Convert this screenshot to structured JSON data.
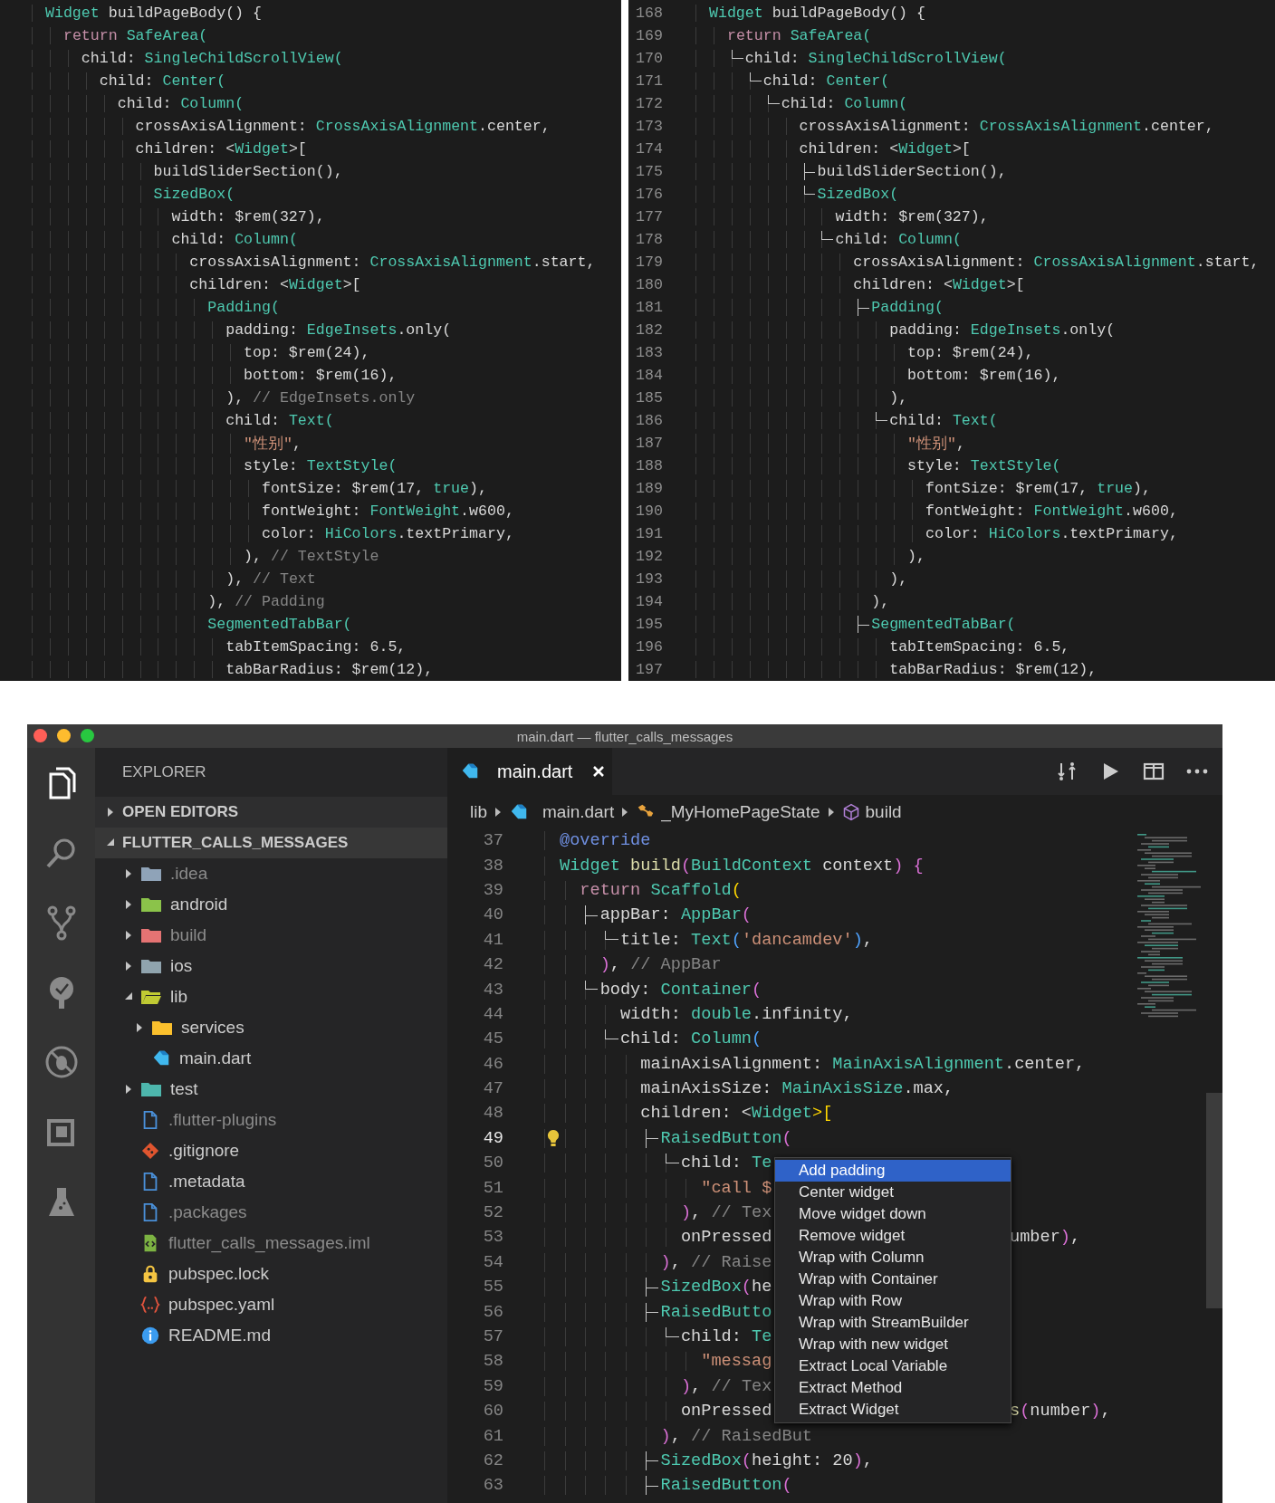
{
  "code_panels": [
    {
      "kind": "plain",
      "lines": [
        {
          "code": [
            {
              "text": "Widget",
              "kind": "type"
            },
            {
              "text": " buildPageBody() {",
              "kind": "plain"
            }
          ]
        },
        {
          "code": [
            {
              "text": "  return",
              "kind": "kw"
            },
            {
              "text": " SafeArea(",
              "kind": "type"
            }
          ]
        },
        {
          "code": [
            {
              "text": "    child: ",
              "kind": "plain"
            },
            {
              "text": "SingleChildScrollView(",
              "kind": "type"
            }
          ]
        },
        {
          "code": [
            {
              "text": "      child: ",
              "kind": "plain"
            },
            {
              "text": "Center(",
              "kind": "type"
            }
          ]
        },
        {
          "code": [
            {
              "text": "        child: ",
              "kind": "plain"
            },
            {
              "text": "Column(",
              "kind": "type"
            }
          ]
        },
        {
          "code": [
            {
              "text": "          crossAxisAlignment: ",
              "kind": "plain"
            },
            {
              "text": "CrossAxisAlignment",
              "kind": "type"
            },
            {
              "text": ".center,",
              "kind": "plain"
            }
          ]
        },
        {
          "code": [
            {
              "text": "          children: <",
              "kind": "plain"
            },
            {
              "text": "Widget",
              "kind": "type"
            },
            {
              "text": ">[",
              "kind": "plain"
            }
          ]
        },
        {
          "code": [
            {
              "text": "            buildSliderSection(),",
              "kind": "plain"
            }
          ]
        },
        {
          "code": [
            {
              "text": "            SizedBox(",
              "kind": "type"
            }
          ]
        },
        {
          "code": [
            {
              "text": "              width: $rem(327),",
              "kind": "plain"
            }
          ]
        },
        {
          "code": [
            {
              "text": "              child: ",
              "kind": "plain"
            },
            {
              "text": "Column(",
              "kind": "type"
            }
          ]
        },
        {
          "code": [
            {
              "text": "                crossAxisAlignment: ",
              "kind": "plain"
            },
            {
              "text": "CrossAxisAlignment",
              "kind": "type"
            },
            {
              "text": ".start,",
              "kind": "plain"
            }
          ]
        },
        {
          "code": [
            {
              "text": "                children: <",
              "kind": "plain"
            },
            {
              "text": "Widget",
              "kind": "type"
            },
            {
              "text": ">[",
              "kind": "plain"
            }
          ]
        },
        {
          "code": [
            {
              "text": "                  Padding(",
              "kind": "type"
            }
          ]
        },
        {
          "code": [
            {
              "text": "                    padding: ",
              "kind": "plain"
            },
            {
              "text": "EdgeInsets",
              "kind": "type"
            },
            {
              "text": ".only(",
              "kind": "plain"
            }
          ]
        },
        {
          "code": [
            {
              "text": "                      top: $rem(24),",
              "kind": "plain"
            }
          ]
        },
        {
          "code": [
            {
              "text": "                      bottom: $rem(16),",
              "kind": "plain"
            }
          ]
        },
        {
          "code": [
            {
              "text": "                    ), ",
              "kind": "plain"
            },
            {
              "text": "// EdgeInsets.only",
              "kind": "comment"
            }
          ]
        },
        {
          "code": [
            {
              "text": "                    child: ",
              "kind": "plain"
            },
            {
              "text": "Text(",
              "kind": "type"
            }
          ]
        },
        {
          "code": [
            {
              "text": "                      \"性别\"",
              "kind": "str"
            },
            {
              "text": ",",
              "kind": "plain"
            }
          ]
        },
        {
          "code": [
            {
              "text": "                      style: ",
              "kind": "plain"
            },
            {
              "text": "TextStyle(",
              "kind": "type"
            }
          ]
        },
        {
          "code": [
            {
              "text": "                        fontSize: $rem(17, ",
              "kind": "plain"
            },
            {
              "text": "true",
              "kind": "type"
            },
            {
              "text": "),",
              "kind": "plain"
            }
          ]
        },
        {
          "code": [
            {
              "text": "                        fontWeight: ",
              "kind": "plain"
            },
            {
              "text": "FontWeight",
              "kind": "type"
            },
            {
              "text": ".w600,",
              "kind": "plain"
            }
          ]
        },
        {
          "code": [
            {
              "text": "                        color: ",
              "kind": "plain"
            },
            {
              "text": "HiColors",
              "kind": "type"
            },
            {
              "text": ".textPrimary,",
              "kind": "plain"
            }
          ]
        },
        {
          "code": [
            {
              "text": "                      ), ",
              "kind": "plain"
            },
            {
              "text": "// TextStyle",
              "kind": "comment"
            }
          ]
        },
        {
          "code": [
            {
              "text": "                    ), ",
              "kind": "plain"
            },
            {
              "text": "// Text",
              "kind": "comment"
            }
          ]
        },
        {
          "code": [
            {
              "text": "                  ), ",
              "kind": "plain"
            },
            {
              "text": "// Padding",
              "kind": "comment"
            }
          ]
        },
        {
          "code": [
            {
              "text": "                  SegmentedTabBar(",
              "kind": "type"
            }
          ]
        },
        {
          "code": [
            {
              "text": "                    tabItemSpacing: 6.5,",
              "kind": "plain"
            }
          ]
        },
        {
          "code": [
            {
              "text": "                    tabBarRadius: $rem(12),",
              "kind": "plain"
            }
          ]
        }
      ]
    },
    {
      "kind": "numbered",
      "lines": [
        {
          "number": "168",
          "code": [
            {
              "text": "Widget",
              "kind": "type"
            },
            {
              "text": " buildPageBody() {",
              "kind": "plain"
            }
          ]
        },
        {
          "number": "169",
          "code": [
            {
              "text": "  return",
              "kind": "kw"
            },
            {
              "text": " SafeArea(",
              "kind": "type"
            }
          ]
        },
        {
          "number": "170",
          "kind": "corner",
          "code": [
            {
              "text": "    child: ",
              "kind": "plain"
            },
            {
              "text": "SingleChildScrollView(",
              "kind": "type"
            }
          ]
        },
        {
          "number": "171",
          "kind": "corner",
          "code": [
            {
              "text": "      child: ",
              "kind": "plain"
            },
            {
              "text": "Center(",
              "kind": "type"
            }
          ]
        },
        {
          "number": "172",
          "kind": "corner",
          "code": [
            {
              "text": "        child: ",
              "kind": "plain"
            },
            {
              "text": "Column(",
              "kind": "type"
            }
          ]
        },
        {
          "number": "173",
          "code": [
            {
              "text": "          crossAxisAlignment: ",
              "kind": "plain"
            },
            {
              "text": "CrossAxisAlignment",
              "kind": "type"
            },
            {
              "text": ".center,",
              "kind": "plain"
            }
          ]
        },
        {
          "number": "174",
          "code": [
            {
              "text": "          children: <",
              "kind": "plain"
            },
            {
              "text": "Widget",
              "kind": "type"
            },
            {
              "text": ">[",
              "kind": "plain"
            }
          ]
        },
        {
          "number": "175",
          "kind": "tee",
          "code": [
            {
              "text": "            buildSliderSection(),",
              "kind": "plain"
            }
          ]
        },
        {
          "number": "176",
          "kind": "corner",
          "code": [
            {
              "text": "            SizedBox(",
              "kind": "type"
            }
          ]
        },
        {
          "number": "177",
          "code": [
            {
              "text": "              width: $rem(327),",
              "kind": "plain"
            }
          ]
        },
        {
          "number": "178",
          "kind": "corner",
          "code": [
            {
              "text": "              child: ",
              "kind": "plain"
            },
            {
              "text": "Column(",
              "kind": "type"
            }
          ]
        },
        {
          "number": "179",
          "code": [
            {
              "text": "                crossAxisAlignment: ",
              "kind": "plain"
            },
            {
              "text": "CrossAxisAlignment",
              "kind": "type"
            },
            {
              "text": ".start,",
              "kind": "plain"
            }
          ]
        },
        {
          "number": "180",
          "code": [
            {
              "text": "                children: <",
              "kind": "plain"
            },
            {
              "text": "Widget",
              "kind": "type"
            },
            {
              "text": ">[",
              "kind": "plain"
            }
          ]
        },
        {
          "number": "181",
          "kind": "tee",
          "code": [
            {
              "text": "                  Padding(",
              "kind": "type"
            }
          ]
        },
        {
          "number": "182",
          "code": [
            {
              "text": "                    padding: ",
              "kind": "plain"
            },
            {
              "text": "EdgeInsets",
              "kind": "type"
            },
            {
              "text": ".only(",
              "kind": "plain"
            }
          ]
        },
        {
          "number": "183",
          "code": [
            {
              "text": "                      top: $rem(24),",
              "kind": "plain"
            }
          ]
        },
        {
          "number": "184",
          "code": [
            {
              "text": "                      bottom: $rem(16),",
              "kind": "plain"
            }
          ]
        },
        {
          "number": "185",
          "code": [
            {
              "text": "                    ),",
              "kind": "plain"
            }
          ]
        },
        {
          "number": "186",
          "kind": "corner",
          "code": [
            {
              "text": "                    child: ",
              "kind": "plain"
            },
            {
              "text": "Text(",
              "kind": "type"
            }
          ]
        },
        {
          "number": "187",
          "code": [
            {
              "text": "                      \"性别\"",
              "kind": "str"
            },
            {
              "text": ",",
              "kind": "plain"
            }
          ]
        },
        {
          "number": "188",
          "code": [
            {
              "text": "                      style: ",
              "kind": "plain"
            },
            {
              "text": "TextStyle(",
              "kind": "type"
            }
          ]
        },
        {
          "number": "189",
          "code": [
            {
              "text": "                        fontSize: $rem(17, ",
              "kind": "plain"
            },
            {
              "text": "true",
              "kind": "type"
            },
            {
              "text": "),",
              "kind": "plain"
            }
          ]
        },
        {
          "number": "190",
          "code": [
            {
              "text": "                        fontWeight: ",
              "kind": "plain"
            },
            {
              "text": "FontWeight",
              "kind": "type"
            },
            {
              "text": ".w600,",
              "kind": "plain"
            }
          ]
        },
        {
          "number": "191",
          "code": [
            {
              "text": "                        color: ",
              "kind": "plain"
            },
            {
              "text": "HiColors",
              "kind": "type"
            },
            {
              "text": ".textPrimary,",
              "kind": "plain"
            }
          ]
        },
        {
          "number": "192",
          "code": [
            {
              "text": "                      ),",
              "kind": "plain"
            }
          ]
        },
        {
          "number": "193",
          "code": [
            {
              "text": "                    ),",
              "kind": "plain"
            }
          ]
        },
        {
          "number": "194",
          "code": [
            {
              "text": "                  ),",
              "kind": "plain"
            }
          ]
        },
        {
          "number": "195",
          "kind": "tee",
          "code": [
            {
              "text": "                  SegmentedTabBar(",
              "kind": "type"
            }
          ]
        },
        {
          "number": "196",
          "code": [
            {
              "text": "                    tabItemSpacing: 6.5,",
              "kind": "plain"
            }
          ]
        },
        {
          "number": "197",
          "code": [
            {
              "text": "                    tabBarRadius: $rem(12),",
              "kind": "plain"
            }
          ]
        }
      ]
    }
  ],
  "editor_window": {
    "title": "main.dart — flutter_calls_messages",
    "activity_bar": [
      {
        "kind": "files",
        "selected": true
      },
      {
        "kind": "search",
        "selected": false
      },
      {
        "kind": "source_control",
        "selected": false
      },
      {
        "kind": "outline",
        "selected": false
      },
      {
        "kind": "debug",
        "selected": false
      },
      {
        "kind": "extensions",
        "selected": false
      },
      {
        "kind": "testing",
        "selected": false
      }
    ],
    "sidebar": {
      "title": "EXPLORER",
      "sections": [
        {
          "label": "OPEN EDITORS",
          "expanded": false
        },
        {
          "label": "FLUTTER_CALLS_MESSAGES",
          "expanded": true,
          "items": [
            {
              "label": ".idea",
              "kind": "folder",
              "color": "#8fa3b8",
              "expanded": false,
              "dimmed": true
            },
            {
              "label": "android",
              "kind": "folder",
              "color": "#8bc34a",
              "expanded": false,
              "dimmed": false
            },
            {
              "label": "build",
              "kind": "folder",
              "color": "#e57373",
              "expanded": false,
              "dimmed": true
            },
            {
              "label": "ios",
              "kind": "folder",
              "color": "#90a4ae",
              "expanded": false,
              "dimmed": false
            },
            {
              "label": "lib",
              "kind": "folder",
              "color": "#c0ca33",
              "expanded": true,
              "dimmed": false,
              "children": [
                {
                  "label": "services",
                  "kind": "folder",
                  "color": "#fbc02d",
                  "expanded": false,
                  "dimmed": false
                },
                {
                  "label": "main.dart",
                  "kind": "dart",
                  "dimmed": false
                }
              ]
            },
            {
              "label": "test",
              "kind": "folder",
              "color": "#4db6ac",
              "expanded": false,
              "dimmed": false
            },
            {
              "label": ".flutter-plugins",
              "kind": "file",
              "dimmed": true
            },
            {
              "label": ".gitignore",
              "kind": "git",
              "dimmed": false
            },
            {
              "label": ".metadata",
              "kind": "file",
              "dimmed": false
            },
            {
              "label": ".packages",
              "kind": "file",
              "dimmed": true
            },
            {
              "label": "flutter_calls_messages.iml",
              "kind": "xml",
              "dimmed": true
            },
            {
              "label": "pubspec.lock",
              "kind": "lock",
              "dimmed": false
            },
            {
              "label": "pubspec.yaml",
              "kind": "yaml",
              "dimmed": false
            },
            {
              "label": "README.md",
              "kind": "info",
              "dimmed": false
            }
          ]
        }
      ]
    },
    "tab": {
      "label": "main.dart"
    },
    "breadcrumb": [
      {
        "text": "lib",
        "kind": "folder"
      },
      {
        "text": "main.dart",
        "kind": "dart"
      },
      {
        "text": "_MyHomePageState",
        "kind": "class"
      },
      {
        "text": "build",
        "kind": "method"
      }
    ],
    "lines": [
      {
        "number": "37",
        "current": false,
        "code": [
          {
            "text": "@override",
            "kind": "deco"
          }
        ]
      },
      {
        "number": "38",
        "current": false,
        "code": [
          {
            "text": "Widget",
            "kind": "type"
          },
          {
            "text": " build",
            "kind": "fn"
          },
          {
            "text": "(",
            "kind": "br"
          },
          {
            "text": "BuildContext",
            "kind": "type"
          },
          {
            "text": " context",
            "kind": "plain"
          },
          {
            "text": ") {",
            "kind": "br"
          }
        ]
      },
      {
        "number": "39",
        "current": false,
        "code": [
          {
            "text": "  return",
            "kind": "kw"
          },
          {
            "text": " Scaffold",
            "kind": "type"
          },
          {
            "text": "(",
            "kind": "br2"
          }
        ]
      },
      {
        "number": "40",
        "current": false,
        "kind": "tee",
        "code": [
          {
            "text": "    appBar: ",
            "kind": "plain"
          },
          {
            "text": "AppBar",
            "kind": "type"
          },
          {
            "text": "(",
            "kind": "br"
          }
        ]
      },
      {
        "number": "41",
        "current": false,
        "kind": "corner",
        "code": [
          {
            "text": "      title: ",
            "kind": "plain"
          },
          {
            "text": "Text",
            "kind": "type"
          },
          {
            "text": "(",
            "kind": "br3"
          },
          {
            "text": "'dancamdev'",
            "kind": "str"
          },
          {
            "text": ")",
            "kind": "br3"
          },
          {
            "text": ",",
            "kind": "plain"
          }
        ]
      },
      {
        "number": "42",
        "current": false,
        "code": [
          {
            "text": "    )",
            "kind": "br"
          },
          {
            "text": ", ",
            "kind": "plain"
          },
          {
            "text": "// AppBar",
            "kind": "comment"
          }
        ]
      },
      {
        "number": "43",
        "current": false,
        "kind": "corner",
        "code": [
          {
            "text": "    body: ",
            "kind": "plain"
          },
          {
            "text": "Container",
            "kind": "type"
          },
          {
            "text": "(",
            "kind": "br"
          }
        ]
      },
      {
        "number": "44",
        "current": false,
        "code": [
          {
            "text": "      width: ",
            "kind": "plain"
          },
          {
            "text": "double",
            "kind": "type"
          },
          {
            "text": ".infinity,",
            "kind": "plain"
          }
        ]
      },
      {
        "number": "45",
        "current": false,
        "kind": "corner",
        "code": [
          {
            "text": "      child: ",
            "kind": "plain"
          },
          {
            "text": "Column",
            "kind": "type"
          },
          {
            "text": "(",
            "kind": "br3"
          }
        ]
      },
      {
        "number": "46",
        "current": false,
        "code": [
          {
            "text": "        mainAxisAlignment: ",
            "kind": "plain"
          },
          {
            "text": "MainAxisAlignment",
            "kind": "type"
          },
          {
            "text": ".center,",
            "kind": "plain"
          }
        ]
      },
      {
        "number": "47",
        "current": false,
        "code": [
          {
            "text": "        mainAxisSize: ",
            "kind": "plain"
          },
          {
            "text": "MainAxisSize",
            "kind": "type"
          },
          {
            "text": ".max,",
            "kind": "plain"
          }
        ]
      },
      {
        "number": "48",
        "current": false,
        "code": [
          {
            "text": "        children: <",
            "kind": "plain"
          },
          {
            "text": "Widget",
            "kind": "type"
          },
          {
            "text": ">[",
            "kind": "br2"
          }
        ]
      },
      {
        "number": "49",
        "current": true,
        "kind": "tee",
        "code": [
          {
            "text": "          RaisedButton",
            "kind": "type"
          },
          {
            "text": "(",
            "kind": "br"
          }
        ]
      },
      {
        "number": "50",
        "current": false,
        "kind": "corner",
        "code": [
          {
            "text": "            child: ",
            "kind": "plain"
          },
          {
            "text": "Te",
            "kind": "type"
          }
        ]
      },
      {
        "number": "51",
        "current": false,
        "code": [
          {
            "text": "              \"call $",
            "kind": "str"
          }
        ]
      },
      {
        "number": "52",
        "current": false,
        "code": [
          {
            "text": "            )",
            "kind": "br"
          },
          {
            "text": ", ",
            "kind": "plain"
          },
          {
            "text": "// Tex",
            "kind": "comment"
          }
        ]
      },
      {
        "number": "53",
        "current": false,
        "code": [
          {
            "text": "            onPressed",
            "kind": "plain"
          }
        ],
        "tail": [
          {
            "text": "umber",
            "kind": "plain"
          },
          {
            "text": ")",
            "kind": "br"
          },
          {
            "text": ",",
            "kind": "plain"
          }
        ]
      },
      {
        "number": "54",
        "current": false,
        "code": [
          {
            "text": "          )",
            "kind": "br"
          },
          {
            "text": ", ",
            "kind": "plain"
          },
          {
            "text": "// Raise",
            "kind": "comment"
          }
        ]
      },
      {
        "number": "55",
        "current": false,
        "kind": "tee",
        "code": [
          {
            "text": "          SizedBox",
            "kind": "type"
          },
          {
            "text": "(",
            "kind": "br"
          },
          {
            "text": "he",
            "kind": "plain"
          }
        ]
      },
      {
        "number": "56",
        "current": false,
        "kind": "tee",
        "code": [
          {
            "text": "          RaisedButto",
            "kind": "type"
          }
        ]
      },
      {
        "number": "57",
        "current": false,
        "kind": "corner",
        "code": [
          {
            "text": "            child: ",
            "kind": "plain"
          },
          {
            "text": "Te",
            "kind": "type"
          }
        ]
      },
      {
        "number": "58",
        "current": false,
        "code": [
          {
            "text": "              \"messag",
            "kind": "str"
          }
        ]
      },
      {
        "number": "59",
        "current": false,
        "code": [
          {
            "text": "            )",
            "kind": "br"
          },
          {
            "text": ", ",
            "kind": "plain"
          },
          {
            "text": "// Tex",
            "kind": "comment"
          }
        ]
      },
      {
        "number": "60",
        "current": false,
        "code": [
          {
            "text": "            onPressed",
            "kind": "plain"
          }
        ],
        "tail": [
          {
            "text": "s",
            "kind": "fn"
          },
          {
            "text": "(",
            "kind": "br"
          },
          {
            "text": "number",
            "kind": "plain"
          },
          {
            "text": ")",
            "kind": "br"
          },
          {
            "text": ",",
            "kind": "plain"
          }
        ]
      },
      {
        "number": "61",
        "current": false,
        "code": [
          {
            "text": "          )",
            "kind": "br"
          },
          {
            "text": ", ",
            "kind": "plain"
          },
          {
            "text": "// RaisedBut",
            "kind": "comment"
          }
        ]
      },
      {
        "number": "62",
        "current": false,
        "kind": "tee",
        "code": [
          {
            "text": "          SizedBox",
            "kind": "type"
          },
          {
            "text": "(",
            "kind": "br"
          },
          {
            "text": "height: 20",
            "kind": "plain"
          },
          {
            "text": ")",
            "kind": "br"
          },
          {
            "text": ",",
            "kind": "plain"
          }
        ]
      },
      {
        "number": "63",
        "current": false,
        "kind": "tee",
        "code": [
          {
            "text": "          RaisedButton",
            "kind": "type"
          },
          {
            "text": "(",
            "kind": "br"
          }
        ]
      }
    ],
    "context_menu": [
      {
        "label": "Add padding",
        "selected": true
      },
      {
        "label": "Center widget",
        "selected": false
      },
      {
        "label": "Move widget down",
        "selected": false
      },
      {
        "label": "Remove widget",
        "selected": false
      },
      {
        "label": "Wrap with Column",
        "selected": false
      },
      {
        "label": "Wrap with Container",
        "selected": false
      },
      {
        "label": "Wrap with Row",
        "selected": false
      },
      {
        "label": "Wrap with StreamBuilder",
        "selected": false
      },
      {
        "label": "Wrap with new widget",
        "selected": false
      },
      {
        "label": "Extract Local Variable",
        "selected": false
      },
      {
        "label": "Extract Method",
        "selected": false
      },
      {
        "label": "Extract Widget",
        "selected": false
      }
    ]
  }
}
